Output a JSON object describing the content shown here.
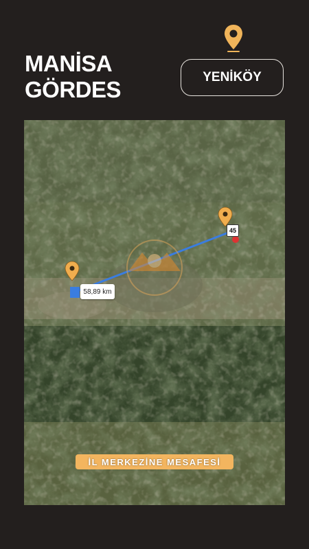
{
  "header": {
    "province": "MANİSA",
    "district": "GÖRDES",
    "village": "YENİKÖY",
    "pin_icon": "location-pin-icon"
  },
  "map": {
    "distance_label": "58,89 km",
    "road_badge": "45",
    "caption": "İL MERKEZİNE MESAFESİ",
    "route_color": "#3a7de0",
    "pin_color": "#f0ad4e"
  },
  "colors": {
    "background": "#231f1e",
    "accent": "#f3b55f"
  }
}
